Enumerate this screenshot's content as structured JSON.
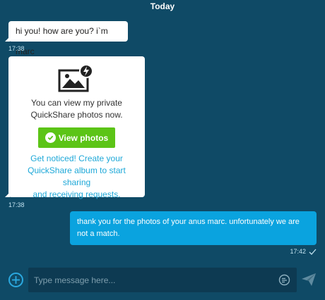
{
  "day_header": "Today",
  "messages": [
    {
      "text": "hi you! how are you? i`m marc",
      "time": "17:38"
    },
    {
      "card_text_line1": "You can view my private",
      "card_text_line2": "QuickShare photos now.",
      "button_label": "View photos",
      "cta_line1": "Get noticed! Create your",
      "cta_line2": "QuickShare album to start sharing",
      "cta_line3": "and receiving requests.",
      "time": "17:38"
    },
    {
      "text_line1": "thank you for the photos of your anus marc. unfortunately we are",
      "text_line2": "not a match.",
      "time": "17:42"
    }
  ],
  "composer": {
    "placeholder": "Type message here..."
  },
  "colors": {
    "background": "#0f4a66",
    "incoming_bubble": "#ffffff",
    "outgoing_bubble": "#0aa3df",
    "button_green": "#5cc417",
    "link_blue": "#1ea8d8",
    "accent": "#2ba9e0"
  },
  "icons": {
    "photo": "image-lightning-icon",
    "check": "check-circle-icon",
    "read": "checkmark-icon",
    "add": "plus-circle-icon",
    "emoji": "emoji-icon",
    "send": "send-icon"
  }
}
